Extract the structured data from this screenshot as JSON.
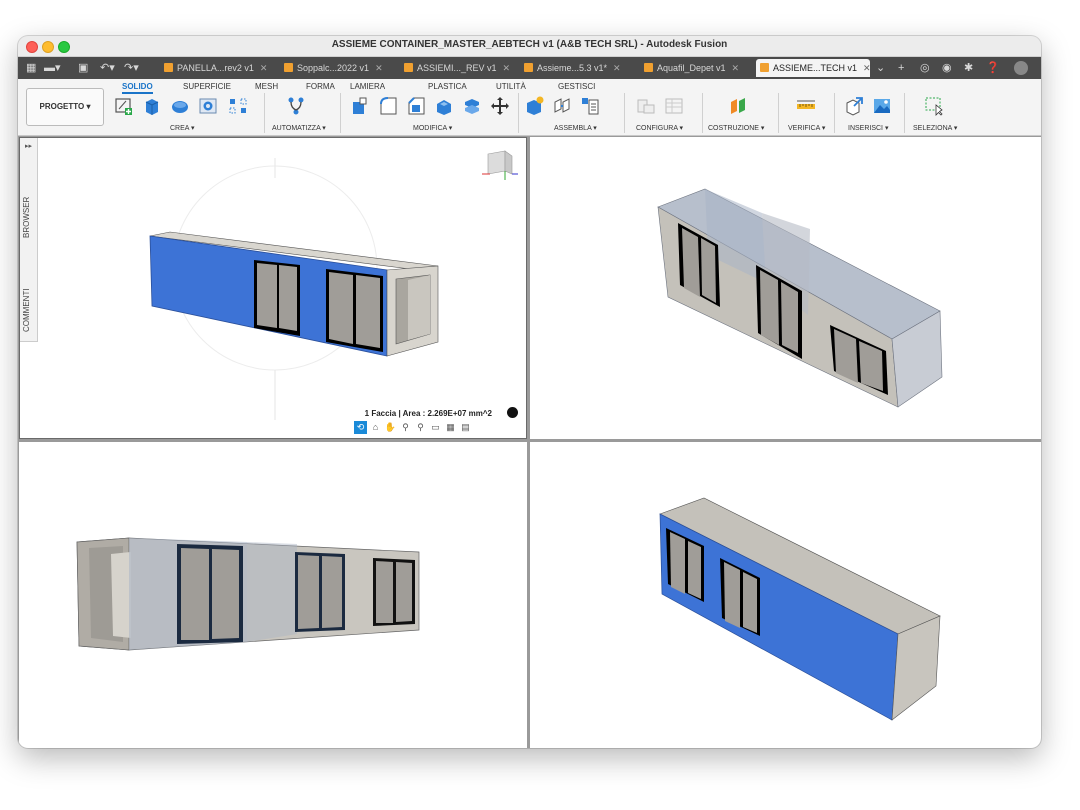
{
  "window": {
    "title": "ASSIEME CONTAINER_MASTER_AEBTECH v1 (A&B TECH SRL) - Autodesk Fusion"
  },
  "tabs": [
    {
      "label": "PANELLA...rev2 v1",
      "active": false
    },
    {
      "label": "Soppalc...2022 v1",
      "active": false
    },
    {
      "label": "ASSIEMI..._REV v1",
      "active": false
    },
    {
      "label": "Assieme...5.3 v1*",
      "active": false
    },
    {
      "label": "Aquafil_Depet v1",
      "active": false
    },
    {
      "label": "ASSIEME...TECH v1",
      "active": true
    }
  ],
  "ribbon": {
    "project_label": "PROGETTO ▾",
    "tabs": [
      "SOLIDO",
      "SUPERFICIE",
      "MESH",
      "FORMA",
      "LAMIERA",
      "PLASTICA",
      "UTILITÀ",
      "GESTISCI"
    ],
    "active_tab": "SOLIDO",
    "groups": [
      "CREA ▾",
      "AUTOMATIZZA ▾",
      "MODIFICA ▾",
      "ASSEMBLA ▾",
      "CONFIGURA ▾",
      "COSTRUZIONE ▾",
      "VERIFICA ▾",
      "INSERISCI ▾",
      "SELEZIONA ▾"
    ]
  },
  "sidepanel": {
    "browser_label": "BROWSER",
    "comments_label": "COMMENTI"
  },
  "viewport": {
    "status_text": "1 Faccia | Area : 2.269E+07 mm^2"
  },
  "colors": {
    "accent": "#1a74c8",
    "selected_face": "#3d73d6",
    "body_face": "#c2bfb8",
    "tab_icon": "#f0a030"
  }
}
